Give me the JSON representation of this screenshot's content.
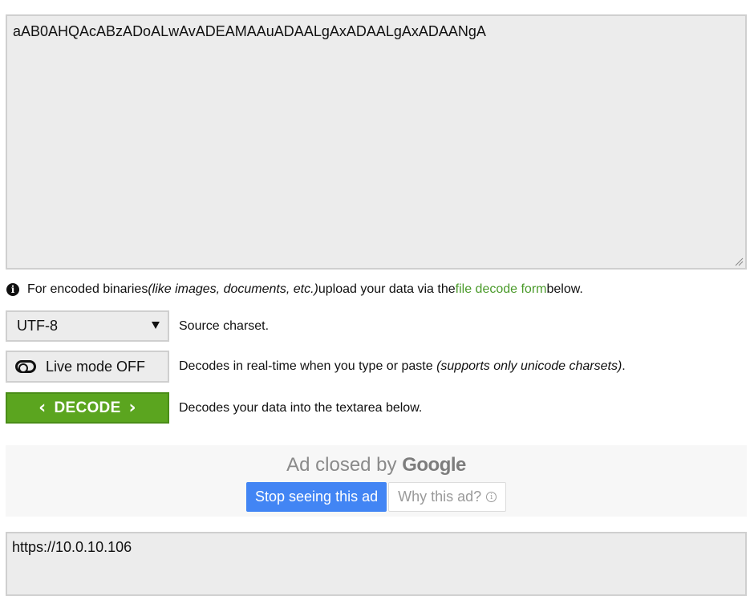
{
  "input": {
    "value": "aAB0AHQAcABzADoALwAvADEAMAAuADAALgAxADAALgAxADAANgA"
  },
  "info": {
    "text_before": "For encoded binaries ",
    "text_italic": "(like images, documents, etc.)",
    "text_middle": " upload your data via the ",
    "link": "file decode form",
    "text_after": " below."
  },
  "charset": {
    "selected": "UTF-8",
    "description": "Source charset."
  },
  "live_mode": {
    "label": "Live mode OFF",
    "description": "Decodes in real-time when you type or paste ",
    "description_italic": "(supports only unicode charsets)",
    "description_end": "."
  },
  "decode": {
    "label": "DECODE",
    "description": "Decodes your data into the textarea below."
  },
  "ad": {
    "closed_text": "Ad closed by ",
    "brand": "Google",
    "stop_label": "Stop seeing this ad",
    "why_label": "Why this ad?",
    "why_icon": "info-icon"
  },
  "output": {
    "value": "https://10.0.10.106"
  },
  "colors": {
    "link": "#4a9a2a",
    "decode_button": "#5ba51f",
    "ad_button": "#4285f4"
  }
}
